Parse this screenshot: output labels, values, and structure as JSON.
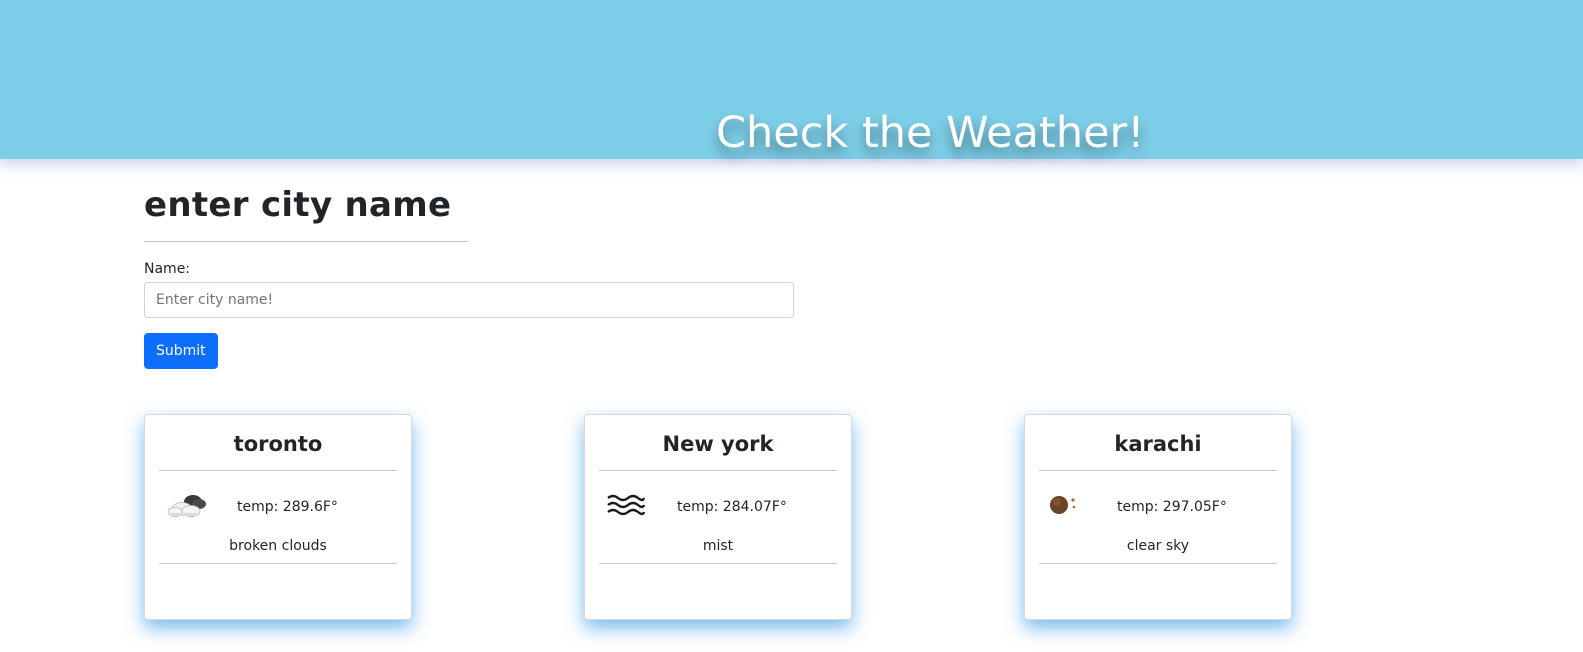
{
  "banner": {
    "title": "Check the Weather!",
    "color": "#7dcee8"
  },
  "form": {
    "heading": "enter city name",
    "label": "Name:",
    "input_value": "",
    "placeholder": "Enter city name!",
    "submit_label": "Submit"
  },
  "cards": [
    {
      "city": "toronto",
      "temp": "temp: 289.6F°",
      "description": "broken clouds",
      "icon": "broken-clouds-icon"
    },
    {
      "city": "New york",
      "temp": "temp: 284.07F°",
      "description": "mist",
      "icon": "mist-icon"
    },
    {
      "city": "karachi",
      "temp": "temp: 297.05F°",
      "description": "clear sky",
      "icon": "clear-sky-icon"
    }
  ]
}
